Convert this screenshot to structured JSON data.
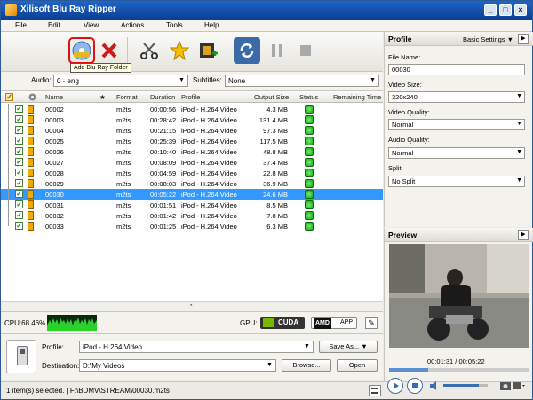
{
  "app": {
    "title": "Xilisoft Blu Ray Ripper",
    "window_buttons": [
      "_",
      "□",
      "×"
    ]
  },
  "menu": [
    "File",
    "Edit",
    "View",
    "Actions",
    "Tools",
    "Help"
  ],
  "tooltip": "Add Blu Ray Folder",
  "filters": {
    "audio_label": "Audio:",
    "audio_value": "0 - eng",
    "subtitles_label": "Subtitles:",
    "subtitles_value": "None"
  },
  "table": {
    "headers": {
      "star": "★",
      "name": "Name",
      "format": "Format",
      "duration": "Duration",
      "profile": "Profile",
      "output_size": "Output Size",
      "status": "Status",
      "remaining": "Remaining Time"
    },
    "rows": [
      {
        "name": "00002",
        "format": "m2ts",
        "duration": "00:00:56",
        "profile": "iPod - H.264 Video",
        "size": "4.3 MB",
        "selected": false
      },
      {
        "name": "00003",
        "format": "m2ts",
        "duration": "00:28:42",
        "profile": "iPod - H.264 Video",
        "size": "131.4 MB",
        "selected": false
      },
      {
        "name": "00004",
        "format": "m2ts",
        "duration": "00:21:15",
        "profile": "iPod - H.264 Video",
        "size": "97.3 MB",
        "selected": false
      },
      {
        "name": "00025",
        "format": "m2ts",
        "duration": "00:25:39",
        "profile": "iPod - H.264 Video",
        "size": "117.5 MB",
        "selected": false
      },
      {
        "name": "00026",
        "format": "m2ts",
        "duration": "00:10:40",
        "profile": "iPod - H.264 Video",
        "size": "48.8 MB",
        "selected": false
      },
      {
        "name": "00027",
        "format": "m2ts",
        "duration": "00:08:09",
        "profile": "iPod - H.264 Video",
        "size": "37.4 MB",
        "selected": false
      },
      {
        "name": "00028",
        "format": "m2ts",
        "duration": "00:04:59",
        "profile": "iPod - H.264 Video",
        "size": "22.8 MB",
        "selected": false
      },
      {
        "name": "00029",
        "format": "m2ts",
        "duration": "00:08:03",
        "profile": "iPod - H.264 Video",
        "size": "36.9 MB",
        "selected": false
      },
      {
        "name": "00030",
        "format": "m2ts",
        "duration": "00:05:22",
        "profile": "iPod - H.264 Video",
        "size": "24.6 MB",
        "selected": true
      },
      {
        "name": "00031",
        "format": "m2ts",
        "duration": "00:01:51",
        "profile": "iPod - H.264 Video",
        "size": "8.5 MB",
        "selected": false
      },
      {
        "name": "00032",
        "format": "m2ts",
        "duration": "00:01:42",
        "profile": "iPod - H.264 Video",
        "size": "7.8 MB",
        "selected": false
      },
      {
        "name": "00033",
        "format": "m2ts",
        "duration": "00:01:25",
        "profile": "iPod - H.264 Video",
        "size": "6.3 MB",
        "selected": false
      }
    ]
  },
  "cpu": {
    "label": "CPU:68.46%",
    "gpu_label": "GPU:",
    "cuda": "CUDA",
    "amd": "AMD",
    "app": "APP"
  },
  "output": {
    "profile_label": "Profile:",
    "profile_value": "iPod - H.264 Video",
    "save_as": "Save As...",
    "destination_label": "Destination:",
    "destination_value": "D:\\My Videos",
    "browse": "Browse...",
    "open": "Open"
  },
  "statusbar": {
    "text": "1 item(s) selected. | F:\\BDMV\\STREAM\\00030.m2ts"
  },
  "profile_panel": {
    "title": "Profile",
    "settings": "Basic Settings",
    "file_name_label": "File Name:",
    "file_name": "00030",
    "video_size_label": "Video Size:",
    "video_size": "320x240",
    "video_quality_label": "Video Quality:",
    "video_quality": "Normal",
    "audio_quality_label": "Audio Quality:",
    "audio_quality": "Normal",
    "split_label": "Split:",
    "split": "No Split"
  },
  "preview": {
    "title": "Preview",
    "time": "00:01:31 / 00:05:22",
    "progress": 0.28,
    "volume": 0.8
  },
  "colors": {
    "selection": "#3399ff",
    "titlebar": "#0a3f94",
    "status_ok": "#16a215"
  }
}
